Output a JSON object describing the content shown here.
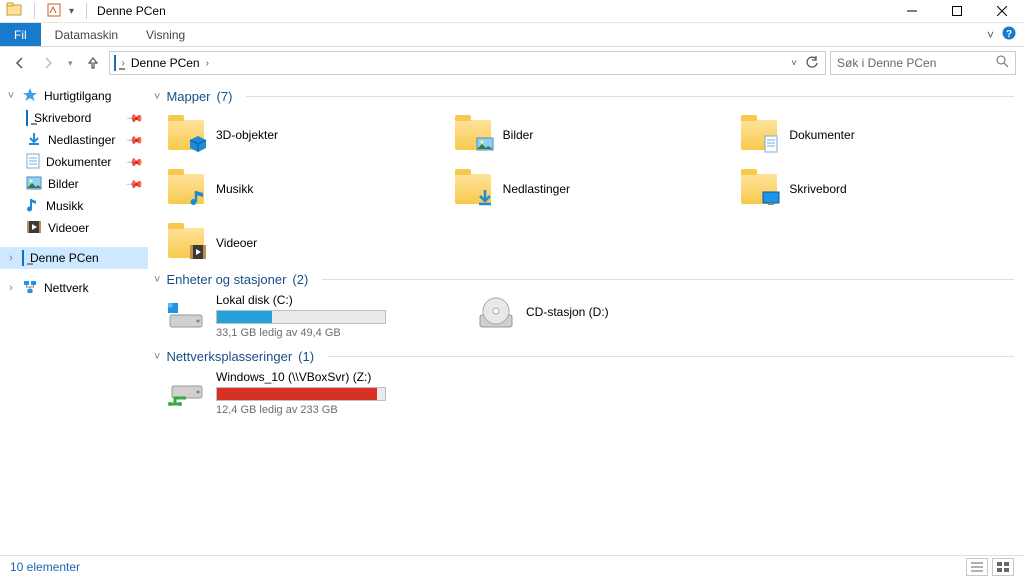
{
  "window": {
    "title": "Denne PCen"
  },
  "ribbon": {
    "file": "Fil",
    "tabs": [
      "Datamaskin",
      "Visning"
    ]
  },
  "breadcrumb": {
    "root": "Denne PCen"
  },
  "search": {
    "placeholder": "Søk i Denne PCen"
  },
  "sidebar": {
    "quick_access": "Hurtigtilgang",
    "items": [
      {
        "label": "Skrivebord",
        "pinned": true
      },
      {
        "label": "Nedlastinger",
        "pinned": true
      },
      {
        "label": "Dokumenter",
        "pinned": true
      },
      {
        "label": "Bilder",
        "pinned": true
      },
      {
        "label": "Musikk",
        "pinned": false
      },
      {
        "label": "Videoer",
        "pinned": false
      }
    ],
    "this_pc": "Denne PCen",
    "network": "Nettverk"
  },
  "groups": {
    "folders": {
      "title": "Mapper",
      "count": "(7)",
      "items": [
        "3D-objekter",
        "Bilder",
        "Dokumenter",
        "Musikk",
        "Nedlastinger",
        "Skrivebord",
        "Videoer"
      ]
    },
    "drives": {
      "title": "Enheter og stasjoner",
      "count": "(2)",
      "local": {
        "name": "Lokal disk (C:)",
        "free_text": "33,1 GB ledig av 49,4 GB",
        "used_pct": 33,
        "color": "#26a0da"
      },
      "optical": {
        "name": "CD-stasjon (D:)"
      }
    },
    "network": {
      "title": "Nettverksplasseringer",
      "count": "(1)",
      "share": {
        "name": "Windows_10 (\\\\VBoxSvr) (Z:)",
        "free_text": "12,4 GB ledig av 233 GB",
        "used_pct": 95,
        "color": "#d93025"
      }
    }
  },
  "statusbar": {
    "count_text": "10 elementer"
  }
}
